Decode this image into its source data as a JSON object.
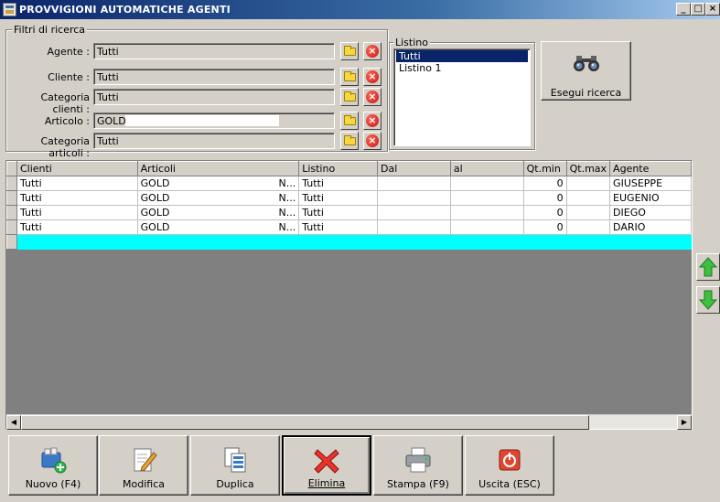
{
  "window": {
    "title": "PROVVIGIONI AUTOMATICHE AGENTI",
    "minimize_glyph": "_",
    "maximize_glyph": "□",
    "close_glyph": "×"
  },
  "filters": {
    "group_label": "Filtri di ricerca",
    "agente_label": "Agente :",
    "agente_value": "Tutti",
    "cliente_label": "Cliente :",
    "cliente_value": "Tutti",
    "categoria_clienti_label": "Categoria clienti :",
    "categoria_clienti_value": "Tutti",
    "articolo_label": "Articolo :",
    "articolo_value": "GOLD",
    "categoria_articoli_label": "Categoria articoli :",
    "categoria_articoli_value": "Tutti",
    "clear_glyph": "×"
  },
  "listino": {
    "group_label": "Listino",
    "options": [
      "Tutti",
      "Listino 1"
    ],
    "selected": "Tutti"
  },
  "search_button": {
    "label": "Esegui ricerca",
    "icon": "binoculars-icon"
  },
  "grid": {
    "columns": [
      "Clienti",
      "Articoli",
      "Listino",
      "Dal",
      "al",
      "Qt.min",
      "Qt.max",
      "Agente"
    ],
    "rows": [
      {
        "clienti": "Tutti",
        "articoli": "GOLD",
        "articoli_suffix": "N...",
        "listino": "Tutti",
        "dal": "",
        "al": "",
        "qt_min": "0",
        "qt_max": "",
        "agente": "GIUSEPPE"
      },
      {
        "clienti": "Tutti",
        "articoli": "GOLD",
        "articoli_suffix": "N...",
        "listino": "Tutti",
        "dal": "",
        "al": "",
        "qt_min": "0",
        "qt_max": "",
        "agente": "EUGENIO"
      },
      {
        "clienti": "Tutti",
        "articoli": "GOLD",
        "articoli_suffix": "N...",
        "listino": "Tutti",
        "dal": "",
        "al": "",
        "qt_min": "0",
        "qt_max": "",
        "agente": "DIEGO"
      },
      {
        "clienti": "Tutti",
        "articoli": "GOLD",
        "articoli_suffix": "N...",
        "listino": "Tutti",
        "dal": "",
        "al": "",
        "qt_min": "0",
        "qt_max": "",
        "agente": "DARIO"
      }
    ],
    "new_row_color": "#00ffff",
    "scroll_left_glyph": "◀",
    "scroll_right_glyph": "▶"
  },
  "nav": {
    "up_icon": "green-arrow-up-icon",
    "down_icon": "green-arrow-down-icon"
  },
  "toolbar": {
    "nuovo": "Nuovo (F4)",
    "modifica": "Modifica",
    "duplica": "Duplica",
    "elimina": "Elimina",
    "stampa": "Stampa (F9)",
    "uscita": "Uscita (ESC)"
  }
}
